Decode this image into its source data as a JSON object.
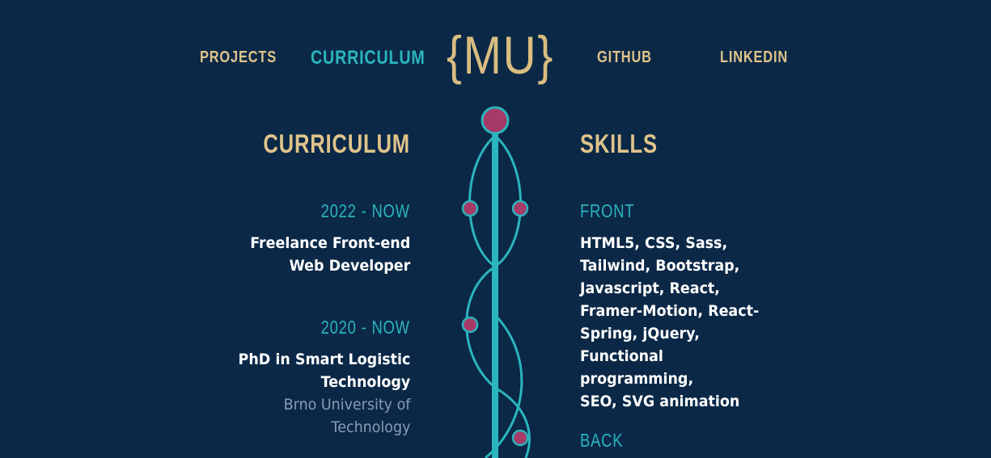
{
  "nav": {
    "projects": "PROJECTS",
    "curriculum": "CURRICULUM",
    "github": "GITHUB",
    "linkedin": "LINKEDIN"
  },
  "logo": "{MU}",
  "curriculum": {
    "title": "CURRICULUM",
    "entries": [
      {
        "period": "2022 - NOW",
        "role": [
          "Freelance Front-end",
          "Web Developer"
        ]
      },
      {
        "period": "2020 - NOW",
        "role": [
          "PhD in Smart Logistic",
          "Technology"
        ],
        "org": [
          "Brno University of",
          "Technology"
        ]
      }
    ]
  },
  "skills": {
    "title": "SKILLS",
    "categories": [
      {
        "name": "FRONT",
        "items": [
          "HTML5, CSS, Sass,",
          "Tailwind, Bootstrap,",
          "Javascript, React,",
          "Framer-Motion, React-",
          "Spring, jQuery,",
          "Functional programming,",
          "SEO, SVG animation"
        ]
      },
      {
        "name": "BACK"
      }
    ]
  },
  "colors": {
    "background": "#0b2847",
    "accent_teal": "#2bb5bd",
    "accent_gold": "#e0c48b",
    "node_magenta": "#a83a68",
    "text_white": "#ffffff",
    "text_muted": "#8a9bb5"
  }
}
